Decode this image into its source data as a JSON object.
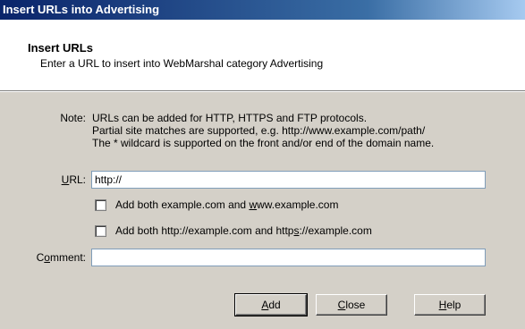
{
  "window": {
    "title": "Insert URLs into Advertising"
  },
  "header": {
    "title": "Insert URLs",
    "subtitle": "Enter a URL to insert into WebMarshal category Advertising"
  },
  "note": {
    "label": "Note:",
    "lines": [
      "URLs can be added for HTTP, HTTPS and FTP protocols.",
      "Partial site matches are supported, e.g. http://www.example.com/path/",
      "The * wildcard is supported on the front and/or end of the domain name."
    ]
  },
  "url": {
    "label_pre": "",
    "label_u": "U",
    "label_post": "RL:",
    "value": "http://"
  },
  "options": [
    {
      "pre": "Add both example.com and ",
      "u": "w",
      "post": "ww.example.com",
      "checked": false
    },
    {
      "pre": "Add both http://example.com and http",
      "u": "s",
      "post": "://example.com",
      "checked": false
    }
  ],
  "comment": {
    "label_pre": "C",
    "label_u": "o",
    "label_post": "mment:",
    "value": ""
  },
  "buttons": [
    {
      "u": "A",
      "rest": "dd"
    },
    {
      "u": "C",
      "rest": "lose"
    },
    {
      "u": "H",
      "rest": "elp"
    }
  ]
}
